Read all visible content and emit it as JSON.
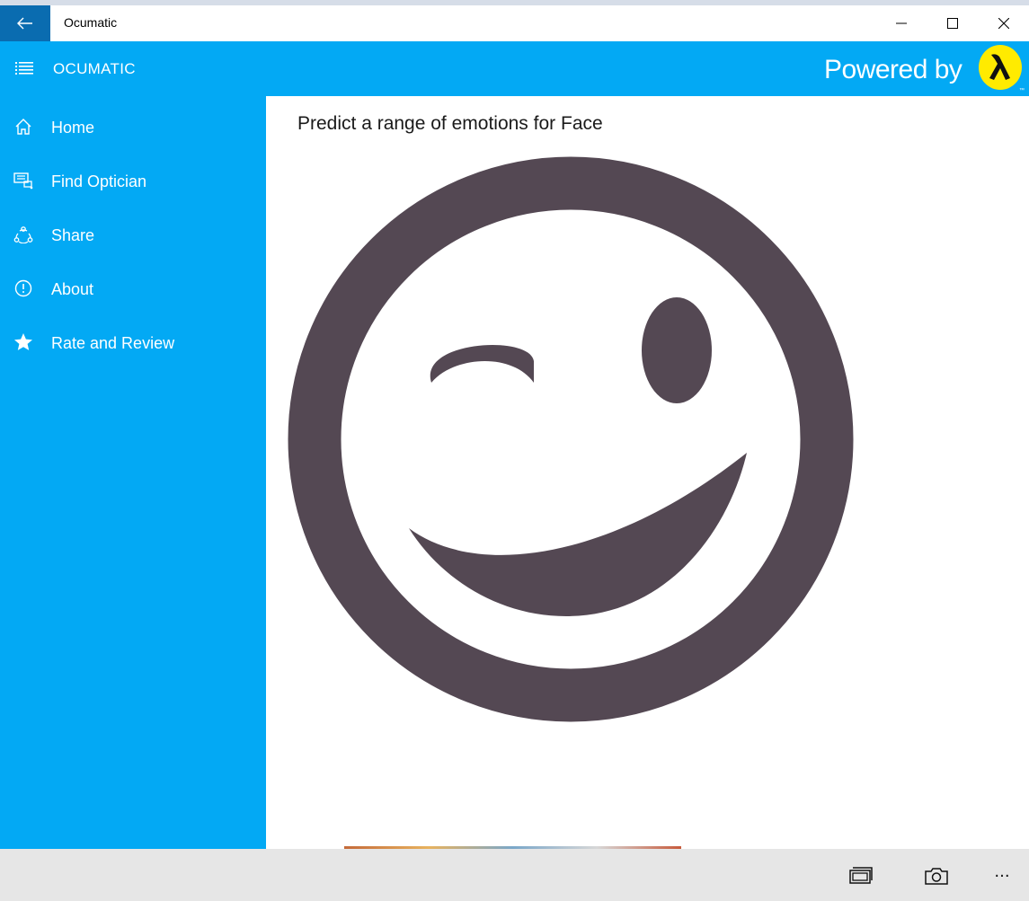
{
  "window": {
    "title": "Ocumatic",
    "controls": [
      "minimize-icon",
      "maximize-icon",
      "close-icon"
    ]
  },
  "appbar": {
    "app_name": "OCUMATIC",
    "powered_by": "Powered by",
    "accent_color": "#03a9f4",
    "logo_color": "#ffeb00"
  },
  "sidebar": {
    "items": [
      {
        "label": "Home",
        "icon": "home-icon"
      },
      {
        "label": "Find Optician",
        "icon": "optician-icon"
      },
      {
        "label": "Share",
        "icon": "share-icon"
      },
      {
        "label": "About",
        "icon": "info-icon"
      },
      {
        "label": "Rate and Review",
        "icon": "star-icon"
      }
    ]
  },
  "main": {
    "heading": "Predict a range of emotions for Face",
    "image": {
      "icon": "winking-face-icon",
      "color": "#544853"
    }
  },
  "cmdbar": {
    "buttons": [
      "gallery-icon",
      "camera-icon",
      "more-icon"
    ],
    "more_label": "···"
  }
}
